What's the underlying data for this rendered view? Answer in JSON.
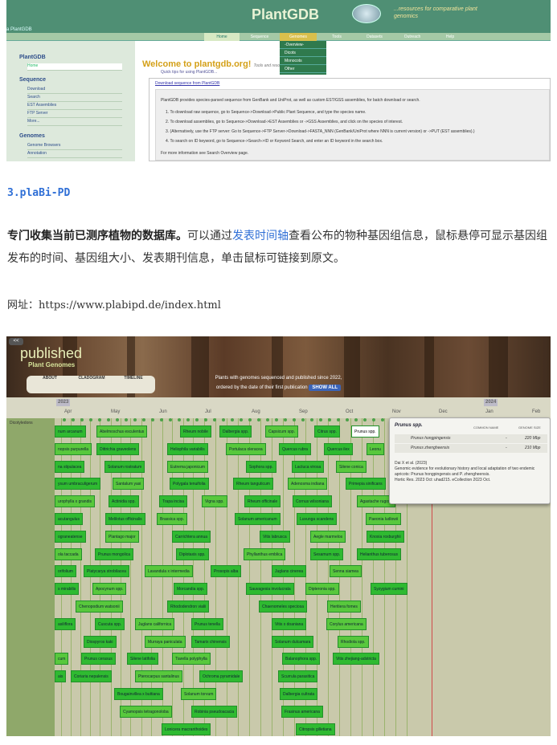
{
  "plantgdb": {
    "logo": "PlantGDB",
    "tagline": "...resources for comparative plant genomics",
    "breadcrumb": "a PlantGDB",
    "nav": [
      "Home",
      "Sequence",
      "Genomes",
      "Tools",
      "Datasets",
      "Outreach",
      "Help"
    ],
    "genomes_menu": [
      "-Overview-",
      "Dicots",
      "Monocots",
      "Other"
    ],
    "sidebar": {
      "title": "PlantGDB",
      "home": "Home",
      "sequence_title": "Sequence",
      "sequence_items": [
        "Download",
        "Search",
        "EST Assemblies",
        "FTP Server",
        "More..."
      ],
      "genomes_title": "Genomes",
      "genomes_items": [
        "Genome Browsers",
        "Annotation"
      ]
    },
    "welcome": "Welcome to plantgdb.org!",
    "welcome_sub": "Tools and resources",
    "quick_tips": "Quick tips for using PlantGDB...",
    "download_link": "Download sequence from PlantGDB",
    "intro": "PlantGDB provides species-parsed sequence from GenBank and UniProt, as well as custom EST/GSS assemblies, for batch download or search.",
    "steps": [
      "1. To download raw sequence, go to Sequence->Download->Public Plant Sequence, and type the species name.",
      "2. To download assemblies, go to Sequence->Download->EST Assemblies or ->GSS Assemblies, and click on the species of interest.",
      "3. (Alternatively, use the FTP server: Go to Sequence->FTP Server->Download->FASTA_NNN (GenBank/UniProt where NNN is current version) or ->PUT (EST assemblies).)",
      "4. To search on ID keyword, go to Sequence->Search->ID or Keyword Search, and enter an ID keyword in the search box."
    ],
    "more_info": "For more information see Search Overview page."
  },
  "article": {
    "section_title": "3.plaBi-PD",
    "para_bold": "专门收集当前已测序植物的数据库。",
    "para_a": "可以通过",
    "para_link": "发表时间轴",
    "para_b": "查看公布的物种基因组信息，鼠标悬停可显示基因组发布的时间、基因组大小、发表期刊信息，单击鼠标可链接到原文。",
    "url": "网址：https://www.plabipd.de/index.html"
  },
  "plabipd": {
    "back": "<<",
    "title": "published",
    "subtitle": "Plant Genomes",
    "tabs": [
      "ABOUT",
      "CLADOGRAM",
      "TIMELINE"
    ],
    "header_line1": "Plants with genomes sequenced and published since 2022,",
    "header_line2": "ordered by the date of their first publication",
    "show_all": "SHOW ALL",
    "year_2023": "2023",
    "year_2024": "2024",
    "months": [
      "Apr",
      "May",
      "Jun",
      "Jul",
      "Aug",
      "Sep",
      "Oct",
      "Nov",
      "Dec",
      "Jan",
      "Feb"
    ],
    "group_label": "Dicotyledons",
    "species_rows": [
      [
        "num arcanum",
        "Abelmoschus esculentus",
        "Rheum nobile",
        "Dalbergia spp.",
        "Capsicum spp.",
        "Citrus spp.",
        "Prunus spp.",
        "Leonu"
      ],
      [
        "nopsis purpurella",
        "Dittrichia graveolens",
        "Heliophila variabilis",
        "Portulaca oleracea",
        "Quercus rubra",
        "Quercus ilex",
        "Leonu"
      ],
      [
        "na stipulacea",
        "Solanum rostratum",
        "Eutrema japonicum",
        "Sophora spp.",
        "Lactuca virosa",
        "Silene conica"
      ],
      [
        "ysum umbraculigerum",
        "Santalum yasi",
        "Polygala tenuifolia",
        "Rheum tanguticum",
        "Adenosma indiana",
        "Primepia sinificans"
      ],
      [
        "urophylla x grandis",
        "Actinidia spp.",
        "Trapa incisa",
        "Vigna spp.",
        "Rheum officinale",
        "Cornus wilsoniana",
        "Agastache rugosa"
      ],
      [
        "acutangulus",
        "Melilotus officinalis",
        "Brassica spp.",
        "Solanum americanum",
        "Luvunga scandens",
        "Paeonia ludlowii"
      ],
      [
        "ograneatense",
        "Plantago major",
        "Carrichtera annua",
        "Vitis labrusca",
        "Aegle marmelos",
        "Knoxia roxburghii"
      ],
      [
        "ola taccada",
        "Prunus mongolica",
        "Diplotaxis spp.",
        "Phyllanthus emblica",
        "Sesamum spp.",
        "Helianthus tuberosus"
      ],
      [
        "orifolium",
        "Platycarya strobilacea",
        "Lavandula x intermedia",
        "Prosopis alba",
        "Juglans cinerea",
        "Senna siamea"
      ],
      [
        "s mirabilis",
        "Apocynum spp.",
        "Morcandia spp.",
        "Sauvagesia involucrata",
        "Dipteronia spp.",
        "Syzygium cumini"
      ],
      [
        "Chenopodium watsonii",
        "Rhododendron vialii",
        "Chaenomeles speciosa",
        "Heritiera fomes"
      ],
      [
        "asiliflora",
        "Cuscuta spp.",
        "Juglans californica",
        "Prunus tenella",
        "Vitis x doaniana",
        "Corylus americana"
      ],
      [
        "Diospyros kaki",
        "Murraya paniculata",
        "Tamarix chinensis",
        "Solanum dulcamara",
        "Rhodiola spp."
      ],
      [
        "cum",
        "Prunus cerasus",
        "Silene latifolia",
        "Tiarella polyphylla",
        "Balanophora spp.",
        "Vitis zhejiang-adstricta"
      ],
      [
        "ais",
        "Coriaria nepalensis",
        "Pterocarpus santalinus",
        "Ochroma pyramidale",
        "Scurrula parasitica"
      ],
      [
        "Bougainvillea x buttiana",
        "Solanum torvum",
        "Dalbergia cultrata"
      ],
      [
        "Cyamopsis tetragonoloba",
        "Robinia pseudoacacia",
        "Frasinus americana"
      ],
      [
        "Lonicera macranthoides",
        "Citropsis gilletiana"
      ]
    ],
    "tooltip": {
      "species": "Prunus spp.",
      "col_common": "COMMON NAME",
      "col_size": "GENOME SIZE",
      "rows": [
        {
          "name": "Prunus hongpingensis",
          "common": "-",
          "size": "220 Mbp"
        },
        {
          "name": "Prunus zhengheensis",
          "common": "-",
          "size": "210 Mbp"
        }
      ],
      "citation": [
        "Dai X et al. (2023)",
        "Genomic evidence for evolutionary history and local adaptation of two endemic apricots: Prunus hongpingensis and P. zhengheensis.",
        "Hortic Res. 2023 Oct: uhad215. eCollection 2023 Oct."
      ]
    }
  }
}
